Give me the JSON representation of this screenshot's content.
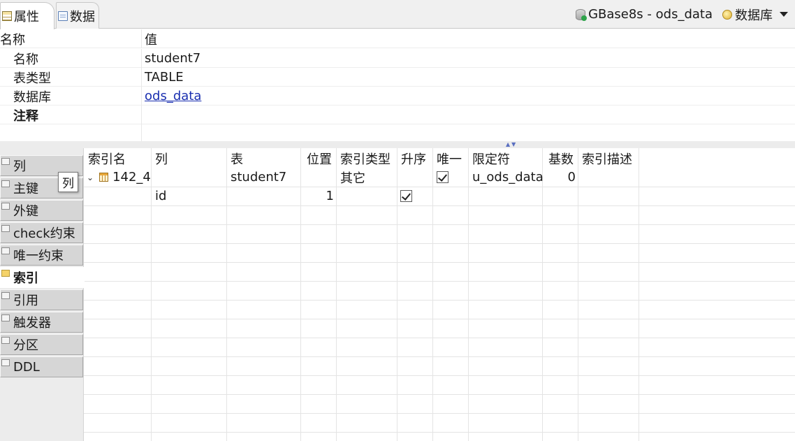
{
  "tabs": [
    {
      "label": "属性",
      "icon": "table-grid-icon",
      "active": true
    },
    {
      "label": "数据",
      "icon": "document-icon",
      "active": false
    }
  ],
  "connection": {
    "label": "GBase8s - ods_data",
    "icon": "database-connection-icon",
    "database_label": "数据库",
    "database_icon": "database-coins-icon"
  },
  "properties": {
    "header": {
      "name": "名称",
      "value": "值"
    },
    "rows": [
      {
        "name": "名称",
        "value": "student7"
      },
      {
        "name": "表类型",
        "value": "TABLE"
      },
      {
        "name": "数据库",
        "value": "ods_data"
      },
      {
        "name": "注释",
        "value": ""
      }
    ]
  },
  "nav": {
    "items": [
      "列",
      "主键",
      "外键",
      "check约束",
      "唯一约束",
      "索引",
      "引用",
      "触发器",
      "分区",
      "DDL"
    ],
    "active_index": 5,
    "tooltip": "列"
  },
  "index_table": {
    "columns": [
      "索引名",
      "列",
      "表",
      "位置",
      "索引类型",
      "升序",
      "唯一",
      "限定符",
      "基数",
      "索引描述"
    ],
    "index_row": {
      "name": "142_4",
      "table": "student7",
      "type": "其它",
      "unique_checked": true,
      "qualifier": "u_ods_data",
      "cardinality": "0"
    },
    "column_row": {
      "column": "id",
      "position": "1",
      "ascending_checked": true
    }
  },
  "colors": {
    "link": "#1a2fb0",
    "nav_bg": "#d6d6d6",
    "grid_line": "#e4e4e4"
  }
}
